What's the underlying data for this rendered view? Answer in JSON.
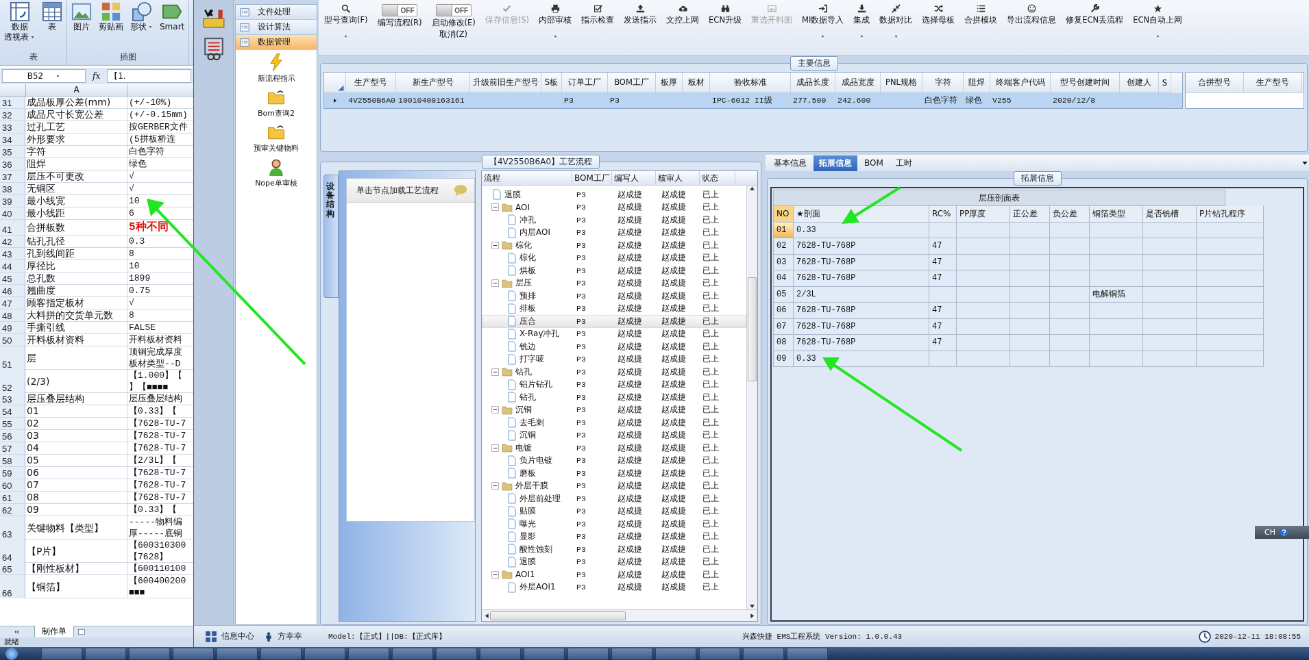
{
  "spreadsheet": {
    "ribbon": {
      "groups": [
        {
          "label": "表",
          "buttons": [
            {
              "lines": [
                "数据",
                "透视表"
              ],
              "menu": true
            },
            {
              "lines": [
                "表"
              ],
              "menu": false
            }
          ]
        },
        {
          "label": "插图",
          "buttons": [
            {
              "lines": [
                "图片"
              ],
              "menu": false
            },
            {
              "lines": [
                "剪贴画"
              ],
              "menu": false
            },
            {
              "lines": [
                "形状"
              ],
              "menu": true
            },
            {
              "lines": [
                "Smart"
              ],
              "menu": false
            }
          ]
        }
      ]
    },
    "name_box": "B52",
    "function_label": "fx",
    "formula": "【1.",
    "column_header": "A",
    "rows": [
      {
        "n": "31",
        "a": "成品板厚公差(mm)",
        "b": [
          "(+/-10%)"
        ],
        "emphasis": false
      },
      {
        "n": "32",
        "a": "成品尺寸长宽公差",
        "b": [
          "(+/-0.15mm)"
        ],
        "emphasis": false
      },
      {
        "n": "33",
        "a": "过孔工艺",
        "b": [
          "按GERBER文件"
        ],
        "emphasis": false
      },
      {
        "n": "34",
        "a": "外形要求",
        "b": [
          "(5拼板桥连"
        ],
        "emphasis": false
      },
      {
        "n": "35",
        "a": "字符",
        "b": [
          "白色字符"
        ],
        "emphasis": false
      },
      {
        "n": "36",
        "a": "阻焊",
        "b": [
          "绿色"
        ],
        "emphasis": false
      },
      {
        "n": "37",
        "a": "层压不可更改",
        "b": [
          "√"
        ],
        "emphasis": false
      },
      {
        "n": "38",
        "a": "无铜区",
        "b": [
          "√"
        ],
        "emphasis": false
      },
      {
        "n": "39",
        "a": "最小线宽",
        "b": [
          "10"
        ],
        "emphasis": false
      },
      {
        "n": "40",
        "a": "最小线距",
        "b": [
          "6"
        ],
        "emphasis": false
      },
      {
        "n": "41",
        "a": "合拼板数",
        "b": [
          "5种不同"
        ],
        "emphasis": true
      },
      {
        "n": "42",
        "a": "钻孔孔径",
        "b": [
          "0.3"
        ],
        "emphasis": false
      },
      {
        "n": "43",
        "a": "孔到线间距",
        "b": [
          "8"
        ],
        "emphasis": false
      },
      {
        "n": "44",
        "a": "厚径比",
        "b": [
          "10"
        ],
        "emphasis": false
      },
      {
        "n": "45",
        "a": "总孔数",
        "b": [
          "1899"
        ],
        "emphasis": false
      },
      {
        "n": "46",
        "a": "翘曲度",
        "b": [
          "0.75"
        ],
        "emphasis": false
      },
      {
        "n": "47",
        "a": "顾客指定板材",
        "b": [
          "√"
        ],
        "emphasis": false
      },
      {
        "n": "48",
        "a": "大料拼的交货单元数",
        "b": [
          "8"
        ],
        "emphasis": false
      },
      {
        "n": "49",
        "a": "手撕引线",
        "b": [
          "FALSE"
        ],
        "emphasis": false
      },
      {
        "n": "50",
        "a": "开料板材资料",
        "b": [
          "开料板材资料"
        ],
        "emphasis": false
      },
      {
        "n": "51",
        "a": "层",
        "b": [
          "顶铜完成厚度",
          "板材类型--D"
        ],
        "emphasis": false
      },
      {
        "n": "52",
        "a": "(2/3)",
        "b": [
          "【1.000】【",
          "】【■■■■"
        ],
        "emphasis": false
      },
      {
        "n": "53",
        "a": "层压叠层结构",
        "b": [
          "层压叠层结构"
        ],
        "emphasis": false
      },
      {
        "n": "54",
        "a": "01",
        "b": [
          "【0.33】【"
        ],
        "emphasis": false
      },
      {
        "n": "55",
        "a": "02",
        "b": [
          "【7628-TU-7"
        ],
        "emphasis": false
      },
      {
        "n": "56",
        "a": "03",
        "b": [
          "【7628-TU-7"
        ],
        "emphasis": false
      },
      {
        "n": "57",
        "a": "04",
        "b": [
          "【7628-TU-7"
        ],
        "emphasis": false
      },
      {
        "n": "58",
        "a": "05",
        "b": [
          "【2/3L】【"
        ],
        "emphasis": false
      },
      {
        "n": "59",
        "a": "06",
        "b": [
          "【7628-TU-7"
        ],
        "emphasis": false
      },
      {
        "n": "60",
        "a": "07",
        "b": [
          "【7628-TU-7"
        ],
        "emphasis": false
      },
      {
        "n": "61",
        "a": "08",
        "b": [
          "【7628-TU-7"
        ],
        "emphasis": false
      },
      {
        "n": "62",
        "a": "09",
        "b": [
          "【0.33】【"
        ],
        "emphasis": false
      },
      {
        "n": "63",
        "a": "关键物料【类型】",
        "b": [
          "-----物料编",
          "厚-----底铜"
        ],
        "emphasis": false
      },
      {
        "n": "64",
        "a": "【P片】",
        "b": [
          "【600310300",
          "【7628】"
        ],
        "emphasis": false
      },
      {
        "n": "65",
        "a": "【刚性板材】",
        "b": [
          "【600110100"
        ],
        "emphasis": false
      },
      {
        "n": "66",
        "a": "【铜箔】",
        "b": [
          "【600400200",
          "■■■"
        ],
        "emphasis": false
      }
    ],
    "sheet_tab": "制作单",
    "status": "就绪"
  },
  "app": {
    "nav": {
      "sections": [
        {
          "label": "文件处理",
          "selected": false
        },
        {
          "label": "设计算法",
          "selected": false
        },
        {
          "label": "数据管理",
          "selected": true
        }
      ],
      "items": [
        "新流程指示",
        "Bom查询2",
        "预审关键物料",
        "Nope单审核"
      ]
    },
    "toolbar": [
      {
        "kind": "button",
        "label": "型号查询(F)",
        "menu": true,
        "disabled": false
      },
      {
        "kind": "toggle",
        "label": "编写流程(R)",
        "switch_text": "OFF",
        "on": false
      },
      {
        "kind": "toggle",
        "label": "启动修改(E)",
        "sublabel": "取消(Z)",
        "switch_text": "OFF",
        "on": false
      },
      {
        "kind": "button",
        "label": "保存信息(S)",
        "menu": false,
        "disabled": true
      },
      {
        "kind": "button",
        "label": "内部审核",
        "menu": true,
        "disabled": false
      },
      {
        "kind": "button",
        "label": "指示检查",
        "menu": false,
        "disabled": false
      },
      {
        "kind": "button",
        "label": "发送指示",
        "menu": false,
        "disabled": false
      },
      {
        "kind": "button",
        "label": "文控上网",
        "menu": false,
        "disabled": false
      },
      {
        "kind": "button",
        "label": "ECN升级",
        "menu": false,
        "disabled": false
      },
      {
        "kind": "button",
        "label": "重选开料图",
        "menu": false,
        "disabled": true
      },
      {
        "kind": "button",
        "label": "MI数据导入",
        "menu": true,
        "disabled": false
      },
      {
        "kind": "button",
        "label": "集成",
        "menu": true,
        "disabled": false
      },
      {
        "kind": "button",
        "label": "数据对比",
        "menu": true,
        "disabled": false
      },
      {
        "kind": "button",
        "label": "选择母板",
        "menu": false,
        "disabled": false
      },
      {
        "kind": "button",
        "label": "合拼模块",
        "menu": false,
        "disabled": false
      },
      {
        "kind": "button",
        "label": "导出流程信息",
        "menu": false,
        "disabled": false
      },
      {
        "kind": "button",
        "label": "修复ECN丢流程",
        "menu": false,
        "disabled": false
      },
      {
        "kind": "button",
        "label": "ECN自动上网",
        "menu": true,
        "disabled": false
      }
    ],
    "main_info": {
      "legend": "主要信息",
      "columns": [
        "生产型号",
        "新生产型号",
        "升级前旧生产型号",
        "S板",
        "订单工厂",
        "BOM工厂",
        "板厚",
        "板材",
        "验收标准",
        "成品长度",
        "成品宽度",
        "PNL规格",
        "字符",
        "阻焊",
        "终端客户代码",
        "型号创建时间",
        "创建人",
        "S"
      ],
      "rows": [
        {
          "selected": true,
          "cells": [
            "4V2550B6A0",
            "10010400163161",
            null,
            null,
            "P3",
            "P3",
            null,
            null,
            "IPC-6012 II级",
            "277.500",
            "242.600",
            null,
            "白色字符",
            "绿色",
            "V255",
            "2020/12/8",
            null,
            null
          ]
        }
      ],
      "merge_columns": [
        "合拼型号",
        "生产型号"
      ]
    },
    "process": {
      "legend": "【4V2550B6A0】工艺流程",
      "side_tab": "设备结构",
      "hint": "单击节点加载工艺流程",
      "columns": [
        "流程",
        "BOM工厂",
        "编写人",
        "核审人",
        "状态"
      ],
      "tree": [
        {
          "label": "退膜",
          "kind": "file",
          "selected": false,
          "bom": "P3",
          "writer": "赵成捷",
          "reviewer": "赵成捷",
          "status": "已上"
        },
        {
          "label": "AOI",
          "kind": "folder",
          "expanded": true,
          "selected": false,
          "bom": "P3",
          "writer": "赵成捷",
          "reviewer": "赵成捷",
          "status": "已上",
          "children": [
            {
              "label": "冲孔",
              "kind": "file",
              "selected": false,
              "bom": "P3",
              "writer": "赵成捷",
              "reviewer": "赵成捷",
              "status": "已上"
            },
            {
              "label": "内层AOI",
              "kind": "file",
              "selected": false,
              "bom": "P3",
              "writer": "赵成捷",
              "reviewer": "赵成捷",
              "status": "已上"
            }
          ]
        },
        {
          "label": "棕化",
          "kind": "folder",
          "expanded": true,
          "selected": false,
          "bom": "P3",
          "writer": "赵成捷",
          "reviewer": "赵成捷",
          "status": "已上",
          "children": [
            {
              "label": "棕化",
              "kind": "file",
              "selected": false,
              "bom": "P3",
              "writer": "赵成捷",
              "reviewer": "赵成捷",
              "status": "已上"
            },
            {
              "label": "烘板",
              "kind": "file",
              "selected": false,
              "bom": "P3",
              "writer": "赵成捷",
              "reviewer": "赵成捷",
              "status": "已上"
            }
          ]
        },
        {
          "label": "层压",
          "kind": "folder",
          "expanded": true,
          "selected": false,
          "bom": "P3",
          "writer": "赵成捷",
          "reviewer": "赵成捷",
          "status": "已上",
          "children": [
            {
              "label": "预排",
              "kind": "file",
              "selected": false,
              "bom": "P3",
              "writer": "赵成捷",
              "reviewer": "赵成捷",
              "status": "已上"
            },
            {
              "label": "排板",
              "kind": "file",
              "selected": false,
              "bom": "P3",
              "writer": "赵成捷",
              "reviewer": "赵成捷",
              "status": "已上"
            },
            {
              "label": "压合",
              "kind": "file",
              "selected": true,
              "bom": "P3",
              "writer": "赵成捷",
              "reviewer": "赵成捷",
              "status": "已上"
            },
            {
              "label": "X-Ray冲孔",
              "kind": "file",
              "selected": false,
              "bom": "P3",
              "writer": "赵成捷",
              "reviewer": "赵成捷",
              "status": "已上"
            },
            {
              "label": "铣边",
              "kind": "file",
              "selected": false,
              "bom": "P3",
              "writer": "赵成捷",
              "reviewer": "赵成捷",
              "status": "已上"
            },
            {
              "label": "打字唛",
              "kind": "file",
              "selected": false,
              "bom": "P3",
              "writer": "赵成捷",
              "reviewer": "赵成捷",
              "status": "已上"
            }
          ]
        },
        {
          "label": "钻孔",
          "kind": "folder",
          "expanded": true,
          "selected": false,
          "bom": "P3",
          "writer": "赵成捷",
          "reviewer": "赵成捷",
          "status": "已上",
          "children": [
            {
              "label": "铝片钻孔",
              "kind": "file",
              "selected": false,
              "bom": "P3",
              "writer": "赵成捷",
              "reviewer": "赵成捷",
              "status": "已上"
            },
            {
              "label": "钻孔",
              "kind": "file",
              "selected": false,
              "bom": "P3",
              "writer": "赵成捷",
              "reviewer": "赵成捷",
              "status": "已上"
            }
          ]
        },
        {
          "label": "沉铜",
          "kind": "folder",
          "expanded": true,
          "selected": false,
          "bom": "P3",
          "writer": "赵成捷",
          "reviewer": "赵成捷",
          "status": "已上",
          "children": [
            {
              "label": "去毛刺",
              "kind": "file",
              "selected": false,
              "bom": "P3",
              "writer": "赵成捷",
              "reviewer": "赵成捷",
              "status": "已上"
            },
            {
              "label": "沉铜",
              "kind": "file",
              "selected": false,
              "bom": "P3",
              "writer": "赵成捷",
              "reviewer": "赵成捷",
              "status": "已上"
            }
          ]
        },
        {
          "label": "电镀",
          "kind": "folder",
          "expanded": true,
          "selected": false,
          "bom": "P3",
          "writer": "赵成捷",
          "reviewer": "赵成捷",
          "status": "已上",
          "children": [
            {
              "label": "负片电镀",
              "kind": "file",
              "selected": false,
              "bom": "P3",
              "writer": "赵成捷",
              "reviewer": "赵成捷",
              "status": "已上"
            },
            {
              "label": "磨板",
              "kind": "file",
              "selected": false,
              "bom": "P3",
              "writer": "赵成捷",
              "reviewer": "赵成捷",
              "status": "已上"
            }
          ]
        },
        {
          "label": "外层干膜",
          "kind": "folder",
          "expanded": true,
          "selected": false,
          "bom": "P3",
          "writer": "赵成捷",
          "reviewer": "赵成捷",
          "status": "已上",
          "children": [
            {
              "label": "外层前处理",
              "kind": "file",
              "selected": false,
              "bom": "P3",
              "writer": "赵成捷",
              "reviewer": "赵成捷",
              "status": "已上"
            },
            {
              "label": "贴膜",
              "kind": "file",
              "selected": false,
              "bom": "P3",
              "writer": "赵成捷",
              "reviewer": "赵成捷",
              "status": "已上"
            },
            {
              "label": "曝光",
              "kind": "file",
              "selected": false,
              "bom": "P3",
              "writer": "赵成捷",
              "reviewer": "赵成捷",
              "status": "已上"
            },
            {
              "label": "显影",
              "kind": "file",
              "selected": false,
              "bom": "P3",
              "writer": "赵成捷",
              "reviewer": "赵成捷",
              "status": "已上"
            },
            {
              "label": "酸性蚀刻",
              "kind": "file",
              "selected": false,
              "bom": "P3",
              "writer": "赵成捷",
              "reviewer": "赵成捷",
              "status": "已上"
            },
            {
              "label": "退膜",
              "kind": "file",
              "selected": false,
              "bom": "P3",
              "writer": "赵成捷",
              "reviewer": "赵成捷",
              "status": "已上"
            }
          ]
        },
        {
          "label": "AOI1",
          "kind": "folder",
          "expanded": true,
          "selected": false,
          "bom": "P3",
          "writer": "赵成捷",
          "reviewer": "赵成捷",
          "status": "已上",
          "children": [
            {
              "label": "外层AOI1",
              "kind": "file",
              "selected": false,
              "bom": "P3",
              "writer": "赵成捷",
              "reviewer": "赵成捷",
              "status": "已上"
            }
          ]
        }
      ]
    },
    "detail": {
      "tabs": [
        {
          "label": "基本信息",
          "selected": false
        },
        {
          "label": "拓展信息",
          "selected": true
        },
        {
          "label": "BOM",
          "selected": false
        },
        {
          "label": "工时",
          "selected": false
        }
      ],
      "legend": "拓展信息",
      "table_title": "层压剖面表",
      "columns": [
        "NO",
        "★剖面",
        "RC%",
        "PP厚度",
        "正公差",
        "负公差",
        "铜箔类型",
        "是否铣槽",
        "P片钻孔程序"
      ],
      "rows": [
        {
          "selected": true,
          "cells": [
            "01",
            "0.33",
            null,
            null,
            null,
            null,
            null,
            null,
            null
          ]
        },
        {
          "selected": false,
          "cells": [
            "02",
            "7628-TU-768P",
            "47",
            null,
            null,
            null,
            null,
            null,
            null
          ]
        },
        {
          "selected": false,
          "cells": [
            "03",
            "7628-TU-768P",
            "47",
            null,
            null,
            null,
            null,
            null,
            null
          ]
        },
        {
          "selected": false,
          "cells": [
            "04",
            "7628-TU-768P",
            "47",
            null,
            null,
            null,
            null,
            null,
            null
          ]
        },
        {
          "selected": false,
          "cells": [
            "05",
            "2/3L",
            null,
            null,
            null,
            null,
            "电解铜箔",
            null,
            null
          ]
        },
        {
          "selected": false,
          "cells": [
            "06",
            "7628-TU-768P",
            "47",
            null,
            null,
            null,
            null,
            null,
            null
          ]
        },
        {
          "selected": false,
          "cells": [
            "07",
            "7628-TU-768P",
            "47",
            null,
            null,
            null,
            null,
            null,
            null
          ]
        },
        {
          "selected": false,
          "cells": [
            "08",
            "7628-TU-768P",
            "47",
            null,
            null,
            null,
            null,
            null,
            null
          ]
        },
        {
          "selected": false,
          "cells": [
            "09",
            "0.33",
            null,
            null,
            null,
            null,
            null,
            null,
            null
          ]
        }
      ]
    },
    "status_bar": {
      "info_center": "信息中心",
      "user": "方幸幸",
      "model": "Model:【正式】||DB:【正式库】",
      "version": "兴森快捷 EMS工程系统 Version: 1.0.0.43",
      "time": "2020-12-11 18:08:55"
    },
    "ime": {
      "label": "CH"
    }
  }
}
